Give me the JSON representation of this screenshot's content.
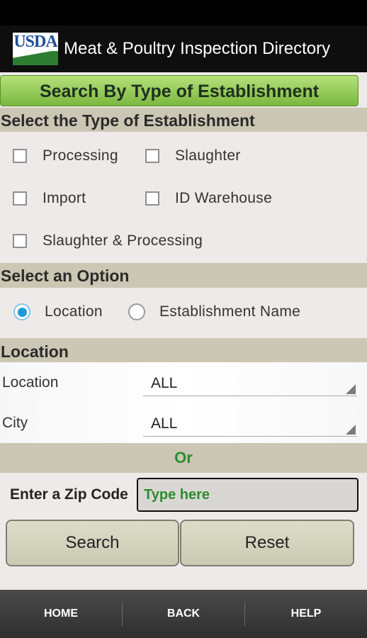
{
  "app": {
    "logo_text": "USDA",
    "title": "Meat & Poultry Inspection Directory"
  },
  "banner": "Search By Type of Establishment",
  "establishment_section": {
    "heading": "Select the Type of Establishment",
    "options": [
      {
        "label": "Processing",
        "checked": false
      },
      {
        "label": "Slaughter",
        "checked": false
      },
      {
        "label": "Import",
        "checked": false
      },
      {
        "label": "ID Warehouse",
        "checked": false
      },
      {
        "label": "Slaughter & Processing",
        "checked": false
      }
    ]
  },
  "option_section": {
    "heading": "Select an Option",
    "options": [
      {
        "label": "Location",
        "selected": true
      },
      {
        "label": "Establishment Name",
        "selected": false
      }
    ]
  },
  "location_section": {
    "heading": "Location",
    "fields": [
      {
        "label": "Location",
        "value": "ALL"
      },
      {
        "label": "City",
        "value": "ALL"
      }
    ]
  },
  "or_label": "Or",
  "zip": {
    "label": "Enter a Zip Code",
    "placeholder": "Type here"
  },
  "buttons": {
    "search": "Search",
    "reset": "Reset"
  },
  "nav": {
    "home": "HOME",
    "back": "BACK",
    "help": "HELP"
  },
  "colors": {
    "banner_green": "#8cc653",
    "section_bg": "#ccc7b4",
    "or_text": "#2e8b2e",
    "radio_accent": "#1e9ad6"
  }
}
